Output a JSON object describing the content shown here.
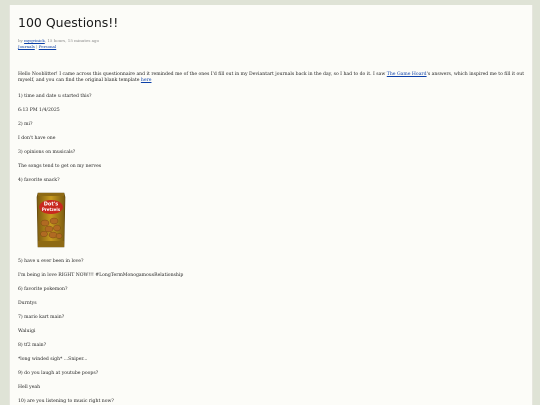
{
  "post": {
    "title": "100 Questions!!",
    "meta_by": "by",
    "author": "myqvinick",
    "meta_time": "15 hours, 15 minutes ago",
    "tags": [
      "Journals",
      "Personal"
    ],
    "tag_sep": "|"
  },
  "intro": {
    "text_1": "Hello Nooblitter! I came across this questionnaire and it reminded me of the ones I'd fill out in my Deviantart journals back in the day, so I had to do it. I saw ",
    "link_1": "The Game Hoard",
    "text_2": "'s answers, which inspired me to fill it out myself, and you can find the original blank template ",
    "link_2": "here"
  },
  "lines": [
    "1) time and date u started this?",
    "6:13 PM 1/4/2025",
    "2) mi?",
    "I don't have one",
    "3) opinions on musicals?",
    "The songs tend to get on my nerves",
    "4) favorite snack?",
    "5) have u ever been in love?",
    "I'm being in love RIGHT NOW!!! #LongTermMonogamousRelationship",
    "6) favorite pokemon?",
    "Durntys",
    "7) mario kart main?",
    "Waluigi",
    "8) tf2 main?",
    "*long winded sigh* ...Sniper...",
    "9) do you laugh at youtube poops?",
    "Hell yeah",
    "10) are you listening to music right now?"
  ],
  "snack_image": {
    "brand": "Dot's",
    "product": "Pretzels",
    "colors": {
      "bag": "#c79a1e",
      "bag_dark": "#7a5a10",
      "label": "#c8281e",
      "pretzel": "#b06a22"
    }
  },
  "colors": {
    "background": "#dfe3d6",
    "page": "#fcfcf8",
    "link": "#0b3fa8"
  }
}
